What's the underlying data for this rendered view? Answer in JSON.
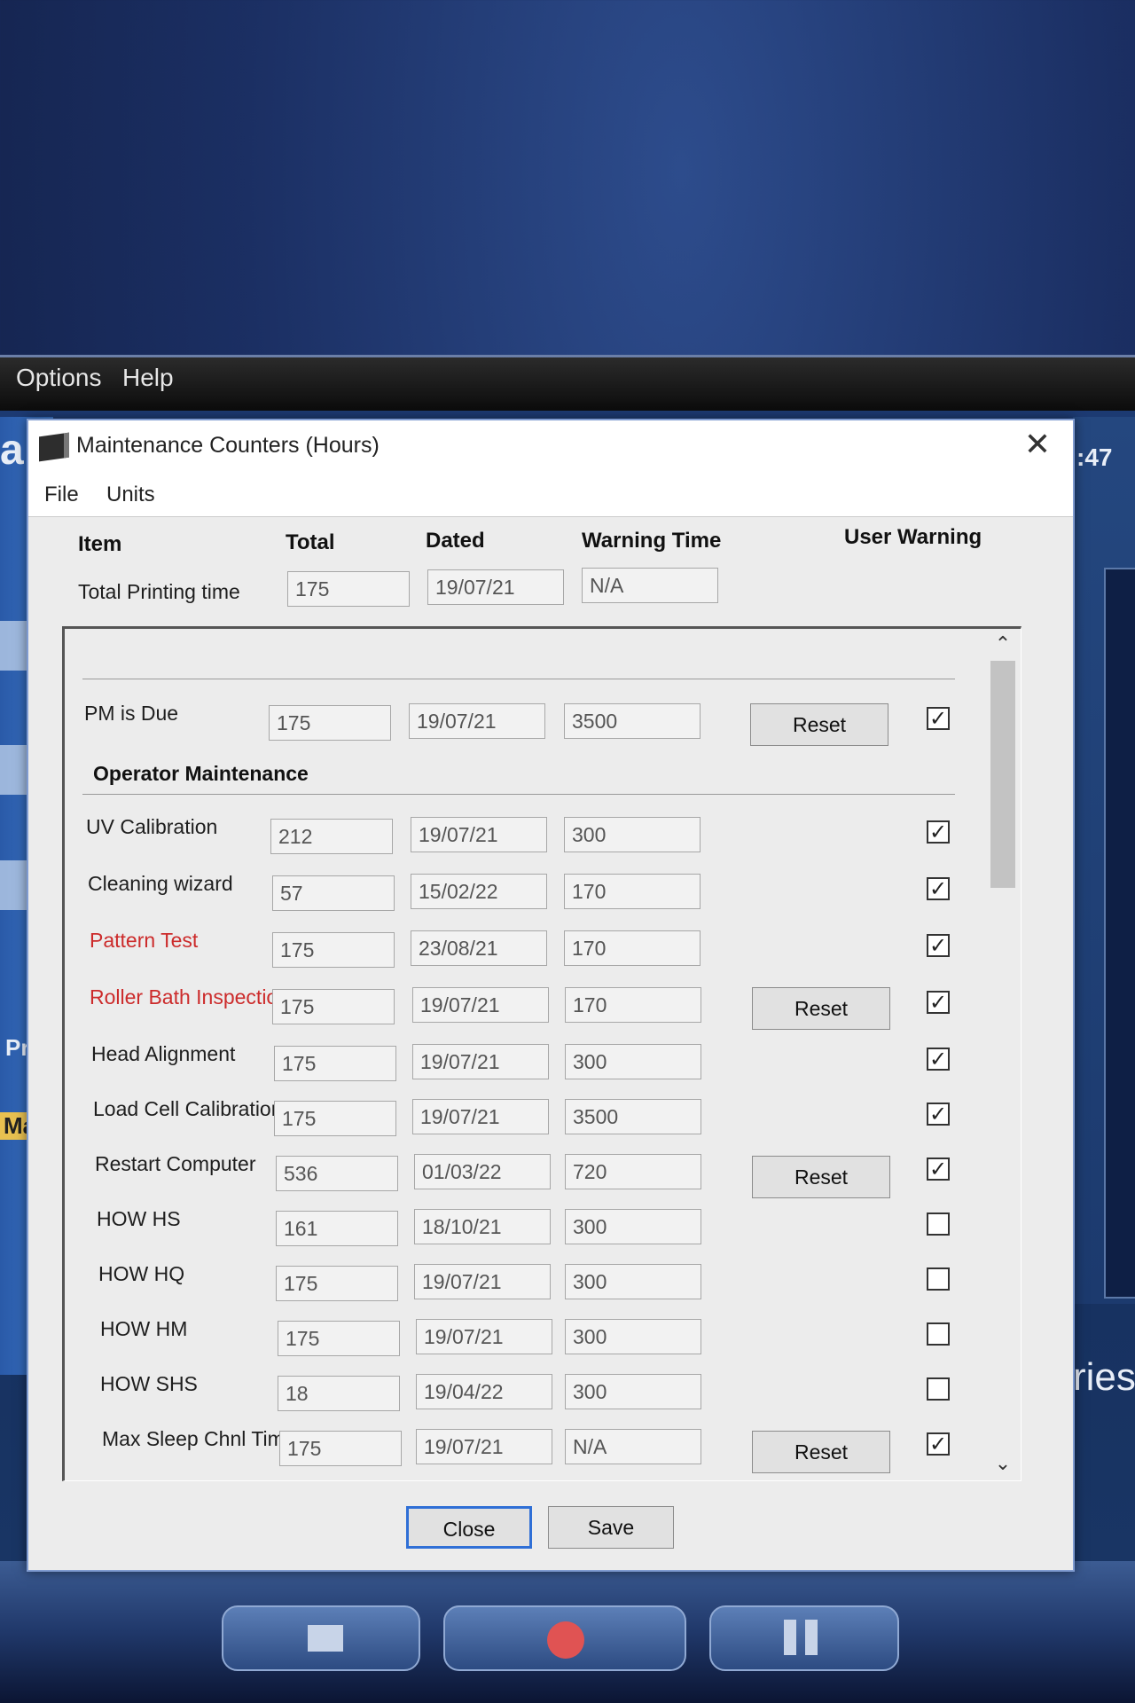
{
  "background_app": {
    "menu": [
      "Options",
      "Help"
    ],
    "fragments": {
      "left_letter": "a",
      "time_fragment": ":47",
      "pre": "Pre",
      "mai": "Mai",
      "ries": "ries"
    }
  },
  "dialog": {
    "title": "Maintenance Counters (Hours)",
    "close_glyph": "✕",
    "menu": [
      "File",
      "Units"
    ],
    "headers": {
      "item": "Item",
      "total": "Total",
      "dated": "Dated",
      "warning_time": "Warning Time",
      "user_warning": "User Warning"
    },
    "total_printing": {
      "label": "Total Printing time",
      "total": "175",
      "dated": "19/07/21",
      "warning": "N/A"
    },
    "rows": [
      {
        "label": "PM is Due",
        "total": "175",
        "dated": "19/07/21",
        "warning": "3500",
        "reset": "Reset",
        "checked": true,
        "red": false
      },
      {
        "label": "UV Calibration",
        "total": "212",
        "dated": "19/07/21",
        "warning": "300",
        "reset": "",
        "checked": true,
        "red": false
      },
      {
        "label": "Cleaning wizard",
        "total": "57",
        "dated": "15/02/22",
        "warning": "170",
        "reset": "",
        "checked": true,
        "red": false
      },
      {
        "label": "Pattern Test",
        "total": "175",
        "dated": "23/08/21",
        "warning": "170",
        "reset": "",
        "checked": true,
        "red": true
      },
      {
        "label": "Roller Bath Inspection",
        "total": "175",
        "dated": "19/07/21",
        "warning": "170",
        "reset": "Reset",
        "checked": true,
        "red": true
      },
      {
        "label": "Head Alignment",
        "total": "175",
        "dated": "19/07/21",
        "warning": "300",
        "reset": "",
        "checked": true,
        "red": false
      },
      {
        "label": "Load Cell Calibration",
        "total": "175",
        "dated": "19/07/21",
        "warning": "3500",
        "reset": "",
        "checked": true,
        "red": false
      },
      {
        "label": "Restart Computer",
        "total": "536",
        "dated": "01/03/22",
        "warning": "720",
        "reset": "Reset",
        "checked": true,
        "red": false
      },
      {
        "label": "HOW HS",
        "total": "161",
        "dated": "18/10/21",
        "warning": "300",
        "reset": "",
        "checked": false,
        "red": false
      },
      {
        "label": "HOW HQ",
        "total": "175",
        "dated": "19/07/21",
        "warning": "300",
        "reset": "",
        "checked": false,
        "red": false
      },
      {
        "label": "HOW HM",
        "total": "175",
        "dated": "19/07/21",
        "warning": "300",
        "reset": "",
        "checked": false,
        "red": false
      },
      {
        "label": "HOW SHS",
        "total": "18",
        "dated": "19/04/22",
        "warning": "300",
        "reset": "",
        "checked": false,
        "red": false
      },
      {
        "label": "Max Sleep Chnl Time",
        "total": "175",
        "dated": "19/07/21",
        "warning": "N/A",
        "reset": "Reset",
        "checked": true,
        "red": false
      }
    ],
    "section_operator": "Operator Maintenance",
    "buttons": {
      "close": "Close",
      "save": "Save"
    },
    "check_glyph": "✓",
    "scroll_up": "⌃",
    "scroll_down": "⌄"
  },
  "colors": {
    "red_label": "#cc2b2b",
    "default_button_border": "#2f6fd6",
    "desktop_blue": "#1b2f63"
  }
}
